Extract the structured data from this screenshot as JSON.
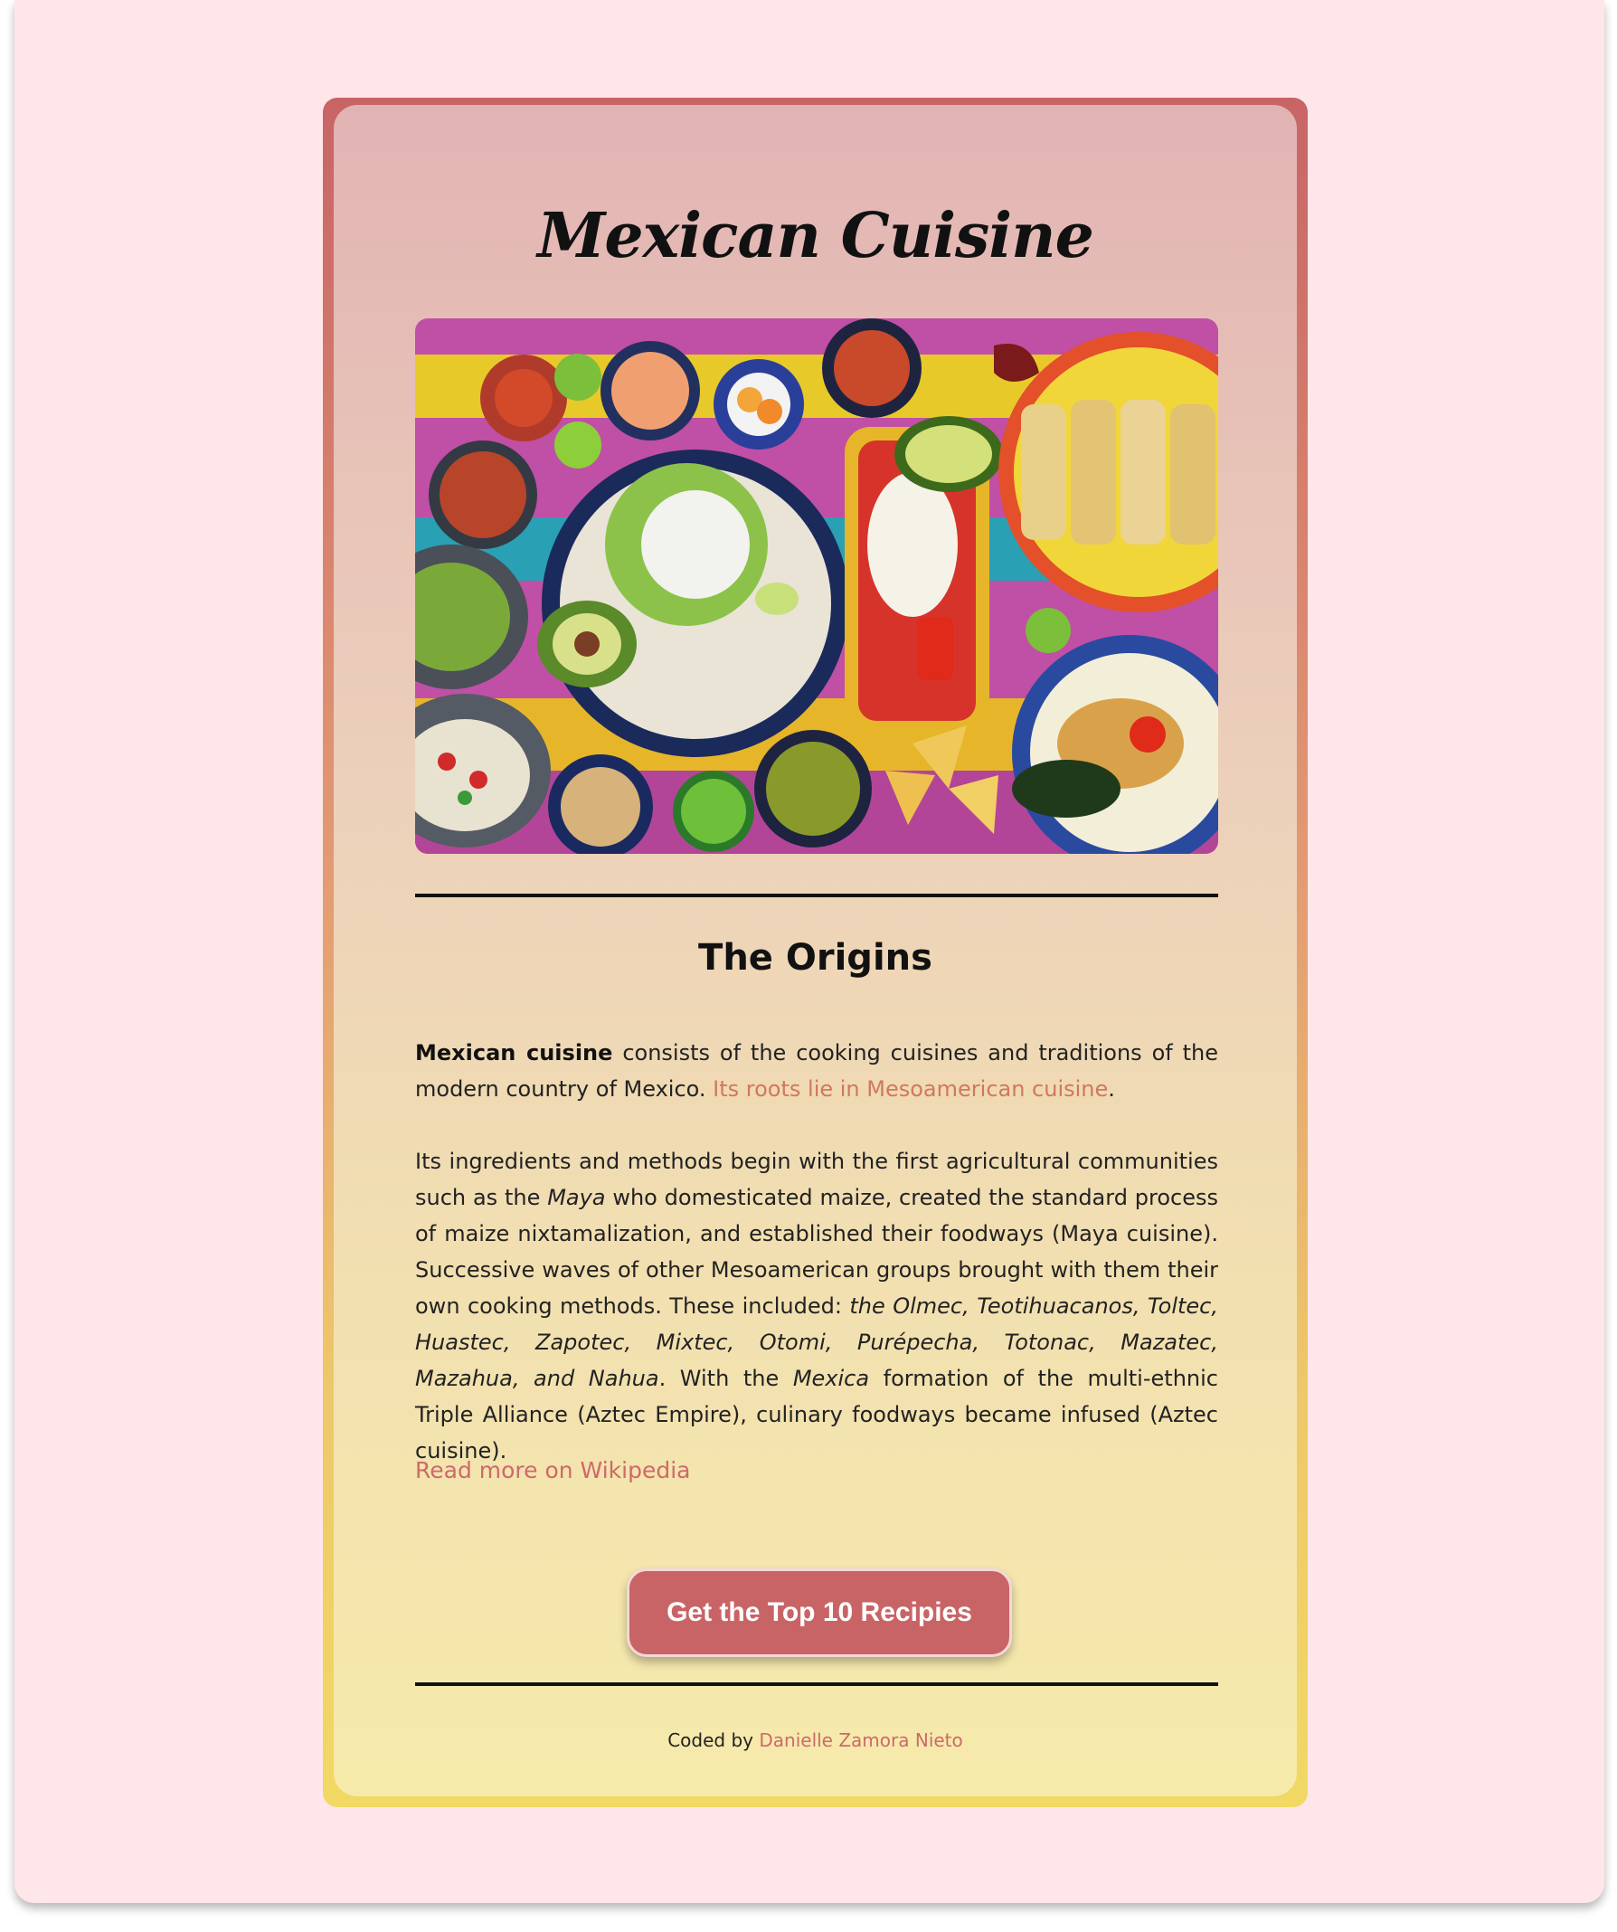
{
  "card": {
    "title": "Mexican Cuisine",
    "image_alt": "Assorted Mexican dishes on a colorful table"
  },
  "origins": {
    "heading": "The Origins",
    "p1": {
      "bold": "Mexican cuisine",
      "text": " consists of the cooking cuisines and traditions of the modern country of Mexico. ",
      "link": "Its roots lie in Mesoamerican cuisine",
      "end": "."
    },
    "p2": {
      "a": "Its ingredients and methods begin with the first agricultural communities such as the ",
      "maya": "Maya",
      "b": " who domesticated maize, created the standard process of maize nixtamalization, and established their foodways (Maya cuisine). Successive waves of other Mesoamerican groups brought with them their own cooking methods. These included: ",
      "groups": "the Olmec, Teotihuacanos, Toltec, Huastec, Zapotec, Mixtec, Otomi, Purépecha, Totonac, Mazatec, Mazahua, and Nahua",
      "c": ". With the ",
      "mexica": "Mexica",
      "d": " formation of the multi-ethnic Triple Alliance (Aztec Empire), culinary foodways became infused (Aztec cuisine)."
    },
    "wiki_link": "Read more on Wikipedia"
  },
  "cta": {
    "label": "Get the Top 10 Recipies"
  },
  "footer": {
    "prefix": "Coded by ",
    "author": "Danielle Zamora Nieto"
  },
  "colors": {
    "page_bg": "#ffe6e9",
    "accent": "#c96466",
    "link": "#d0785f"
  }
}
